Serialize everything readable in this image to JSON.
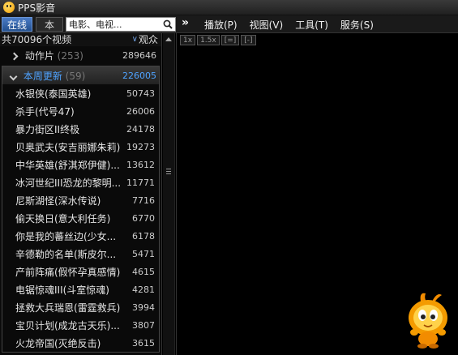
{
  "app": {
    "title": "PPS影音"
  },
  "toolbar": {
    "tab_online": "在线",
    "tab_local": "本地",
    "search_value": "电影、电视...",
    "expand": "»",
    "menu": [
      "播放(P)",
      "视图(V)",
      "工具(T)",
      "服务(S)"
    ]
  },
  "list": {
    "header_total": "共70096个视频",
    "header_sort": "观众",
    "category": {
      "name": "动作片",
      "paren": "(253)",
      "count": "289646"
    },
    "section": {
      "name": "本周更新",
      "paren": "(59)",
      "count": "226005"
    },
    "items": [
      {
        "title": "水银侠(泰国英雄)",
        "count": "50743"
      },
      {
        "title": "杀手(代号47)",
        "count": "26006"
      },
      {
        "title": "暴力街区II终极",
        "count": "24178"
      },
      {
        "title": "贝奥武夫(安吉丽娜朱莉)",
        "count": "19273"
      },
      {
        "title": "中华英雄(舒淇郑伊健)...",
        "count": "13612"
      },
      {
        "title": "冰河世纪III恐龙的黎明...",
        "count": "11771"
      },
      {
        "title": "尼斯湖怪(深水传说)",
        "count": "7716"
      },
      {
        "title": "偷天换日(意大利任务)",
        "count": "6770"
      },
      {
        "title": "你是我的蕃丝边(少女...",
        "count": "6178"
      },
      {
        "title": "辛德勒的名单(斯皮尔...",
        "count": "5471"
      },
      {
        "title": "产前阵痛(假怀孕真感情)",
        "count": "4615"
      },
      {
        "title": "电锯惊魂III(斗室惊魂)",
        "count": "4281"
      },
      {
        "title": "拯救大兵瑞恩(雷霆救兵)",
        "count": "3994"
      },
      {
        "title": "宝贝计划(成龙古天乐)...",
        "count": "3807"
      },
      {
        "title": "火龙帝国(灭绝反击)",
        "count": "3615"
      }
    ]
  },
  "video": {
    "buttons": [
      "1x",
      "1.5x",
      "[=]",
      "[-]"
    ]
  },
  "icons": {
    "logo": "pps-logo-icon",
    "search": "search-icon",
    "mascot": "pps-mascot-icon"
  },
  "colors": {
    "accent_blue": "#4fa3ff",
    "tab_blue": "#23508f",
    "mascot_orange": "#f28c00"
  }
}
